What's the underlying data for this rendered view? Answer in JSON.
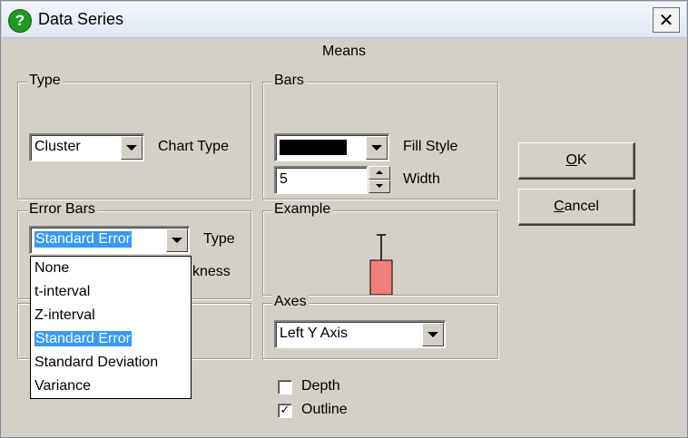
{
  "window": {
    "title": "Data Series",
    "close_label": "✕"
  },
  "header": {
    "subtitle": "Means"
  },
  "type_group": {
    "label": "Type",
    "chart_type_value": "Cluster",
    "chart_type_label": "Chart Type"
  },
  "bars_group": {
    "label": "Bars",
    "fill_style_label": "Fill Style",
    "fill_color": "#000000",
    "width_value": "5",
    "width_label": "Width"
  },
  "error_bars_group": {
    "label": "Error Bars",
    "type_value": "Standard Error",
    "type_label": "Type",
    "thickness_label_partial": "kness"
  },
  "example_group": {
    "label": "Example",
    "bar_color": "#f08080"
  },
  "axes_group": {
    "label": "Axes",
    "axis_value": "Left Y Axis"
  },
  "buttons": {
    "ok": "OK",
    "ok_mnemonic": "O",
    "ok_rest": "K",
    "cancel": "Cancel",
    "cancel_mnemonic": "C",
    "cancel_rest": "ancel"
  },
  "options": {
    "depth_label": "Depth",
    "depth_checked": false,
    "outline_label": "Outline",
    "outline_checked": true
  },
  "error_type_dropdown": {
    "items": [
      "None",
      "t-interval",
      "Z-interval",
      "Standard Error",
      "Standard Deviation",
      "Variance"
    ],
    "selected": "Standard Error"
  }
}
